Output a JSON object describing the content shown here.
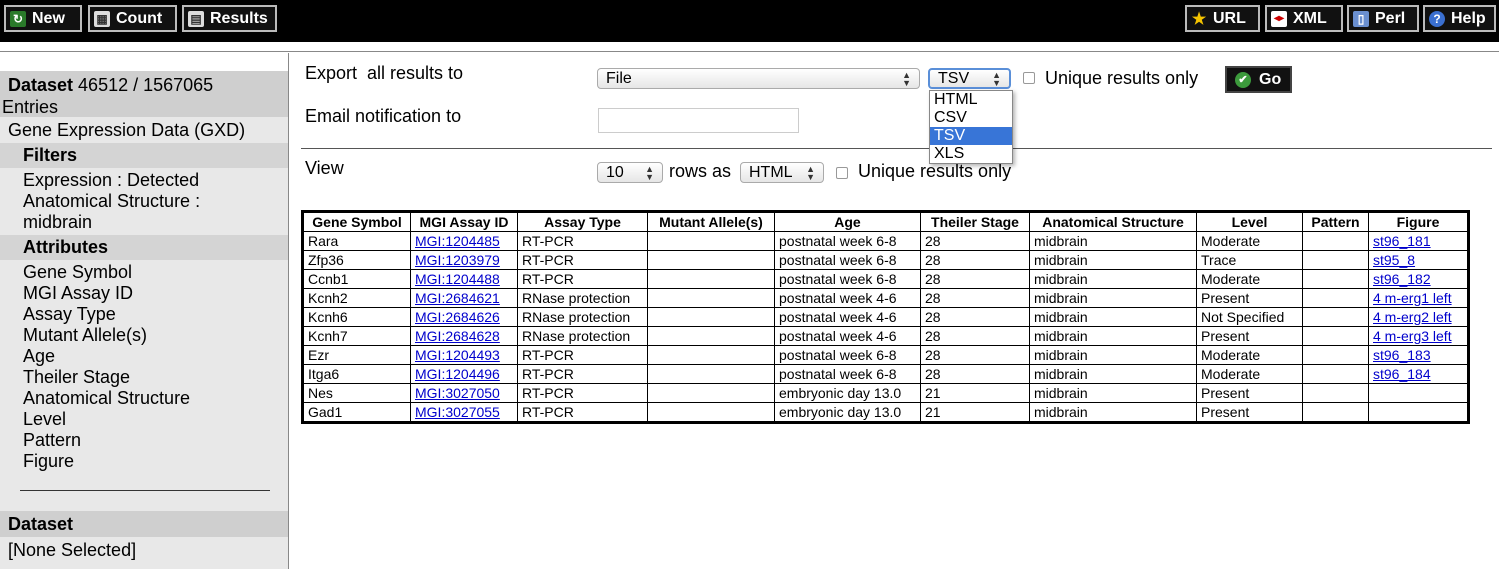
{
  "toolbar": {
    "new_label": "New",
    "count_label": "Count",
    "results_label": "Results",
    "url_label": "URL",
    "xml_label": "XML",
    "perl_label": "Perl",
    "help_label": "Help"
  },
  "sidebar": {
    "dataset_label": "Dataset",
    "dataset_count": "46512 / 1567065",
    "entries_label": "Entries",
    "dataset_name": "Gene Expression Data (GXD)",
    "filters_heading": "Filters",
    "filters": [
      "Expression : Detected",
      "Anatomical Structure :",
      "midbrain"
    ],
    "attributes_heading": "Attributes",
    "attributes": [
      "Gene Symbol",
      "MGI Assay ID",
      "Assay Type",
      "Mutant Allele(s)",
      "Age",
      "Theiler Stage",
      "Anatomical Structure",
      "Level",
      "Pattern",
      "Figure"
    ],
    "dataset2_heading": "Dataset",
    "dataset2_value": "[None Selected]"
  },
  "export": {
    "label": "Export  all results to",
    "destination": "File",
    "format": "TSV",
    "format_options": [
      "HTML",
      "CSV",
      "TSV",
      "XLS"
    ],
    "unique_label": "Unique results only",
    "go_label": "Go",
    "email_label": "Email notification to",
    "email_value": ""
  },
  "view": {
    "label": "View",
    "rows": "10",
    "rows_as_label": "rows as",
    "format": "HTML",
    "unique_label": "Unique results only"
  },
  "table": {
    "headers": [
      "Gene Symbol",
      "MGI Assay ID",
      "Assay Type",
      "Mutant Allele(s)",
      "Age",
      "Theiler Stage",
      "Anatomical Structure",
      "Level",
      "Pattern",
      "Figure"
    ],
    "rows": [
      [
        "Rara",
        "MGI:1204485",
        "RT-PCR",
        "",
        "postnatal week 6-8",
        "28",
        "midbrain",
        "Moderate",
        "",
        "st96_181"
      ],
      [
        "Zfp36",
        "MGI:1203979",
        "RT-PCR",
        "",
        "postnatal week 6-8",
        "28",
        "midbrain",
        "Trace",
        "",
        "st95_8"
      ],
      [
        "Ccnb1",
        "MGI:1204488",
        "RT-PCR",
        "",
        "postnatal week 6-8",
        "28",
        "midbrain",
        "Moderate",
        "",
        "st96_182"
      ],
      [
        "Kcnh2",
        "MGI:2684621",
        "RNase protection",
        "",
        "postnatal week 4-6",
        "28",
        "midbrain",
        "Present",
        "",
        "4 m-erg1 left"
      ],
      [
        "Kcnh6",
        "MGI:2684626",
        "RNase protection",
        "",
        "postnatal week 4-6",
        "28",
        "midbrain",
        "Not Specified",
        "",
        "4 m-erg2 left"
      ],
      [
        "Kcnh7",
        "MGI:2684628",
        "RNase protection",
        "",
        "postnatal week 4-6",
        "28",
        "midbrain",
        "Present",
        "",
        "4 m-erg3 left"
      ],
      [
        "Ezr",
        "MGI:1204493",
        "RT-PCR",
        "",
        "postnatal week 6-8",
        "28",
        "midbrain",
        "Moderate",
        "",
        "st96_183"
      ],
      [
        "Itga6",
        "MGI:1204496",
        "RT-PCR",
        "",
        "postnatal week 6-8",
        "28",
        "midbrain",
        "Moderate",
        "",
        "st96_184"
      ],
      [
        "Nes",
        "MGI:3027050",
        "RT-PCR",
        "",
        "embryonic day 13.0",
        "21",
        "midbrain",
        "Present",
        "",
        ""
      ],
      [
        "Gad1",
        "MGI:3027055",
        "RT-PCR",
        "",
        "embryonic day 13.0",
        "21",
        "midbrain",
        "Present",
        "",
        ""
      ]
    ]
  },
  "icons": {
    "new": "refresh-icon",
    "count": "calculator-icon",
    "results": "table-icon",
    "url": "star-icon",
    "xml": "xml-icon",
    "perl": "document-icon",
    "help": "help-icon",
    "go": "checkmark-icon"
  },
  "colors": {
    "toolbar_bg": "#000000",
    "sidebar_bg": "#e8e8e8",
    "link": "#0000cc",
    "selected_option": "#3875d7",
    "go_icon": "#3c9a3c"
  }
}
